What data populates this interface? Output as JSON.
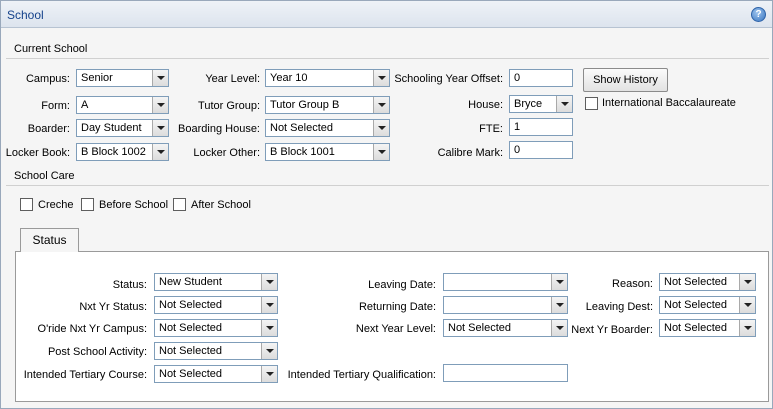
{
  "window": {
    "title": "School"
  },
  "current_school": {
    "heading": "Current School",
    "campus": {
      "label": "Campus:",
      "value": "Senior"
    },
    "form": {
      "label": "Form:",
      "value": "A"
    },
    "boarder": {
      "label": "Boarder:",
      "value": "Day Student"
    },
    "locker_book": {
      "label": "Locker Book:",
      "value": "B Block 1002"
    },
    "year_level": {
      "label": "Year Level:",
      "value": "Year 10"
    },
    "tutor_group": {
      "label": "Tutor Group:",
      "value": "Tutor Group B"
    },
    "boarding_house": {
      "label": "Boarding House:",
      "value": "Not Selected"
    },
    "locker_other": {
      "label": "Locker Other:",
      "value": "B Block 1001"
    },
    "schooling_year_offset": {
      "label": "Schooling Year Offset:",
      "value": "0"
    },
    "house": {
      "label": "House:",
      "value": "Bryce"
    },
    "fte": {
      "label": "FTE:",
      "value": "1"
    },
    "calibre_mark": {
      "label": "Calibre Mark:",
      "value": "0"
    },
    "show_history_label": "Show History",
    "international_baccalaureate": {
      "label": "International Baccalaureate",
      "checked": false
    }
  },
  "school_care": {
    "heading": "School Care",
    "options": [
      {
        "label": "Creche",
        "checked": false
      },
      {
        "label": "Before School",
        "checked": false
      },
      {
        "label": "After School",
        "checked": false
      }
    ]
  },
  "status_tab": {
    "tab_label": "Status",
    "status": {
      "label": "Status:",
      "value": "New Student"
    },
    "nxt_yr_status": {
      "label": "Nxt Yr Status:",
      "value": "Not Selected"
    },
    "oride_nxt_yr_campus": {
      "label": "O'ride Nxt Yr Campus:",
      "value": "Not Selected"
    },
    "post_school_activity": {
      "label": "Post School Activity:",
      "value": "Not Selected"
    },
    "intended_tertiary_course": {
      "label": "Intended Tertiary Course:",
      "value": "Not Selected"
    },
    "leaving_date": {
      "label": "Leaving Date:",
      "value": ""
    },
    "returning_date": {
      "label": "Returning Date:",
      "value": ""
    },
    "next_year_level": {
      "label": "Next Year Level:",
      "value": "Not Selected"
    },
    "intended_tertiary_qualification": {
      "label": "Intended Tertiary Qualification:",
      "value": ""
    },
    "reason": {
      "label": "Reason:",
      "value": "Not Selected"
    },
    "leaving_dest": {
      "label": "Leaving Dest:",
      "value": "Not Selected"
    },
    "next_yr_boarder": {
      "label": "Next Yr Boarder:",
      "value": "Not Selected"
    }
  }
}
